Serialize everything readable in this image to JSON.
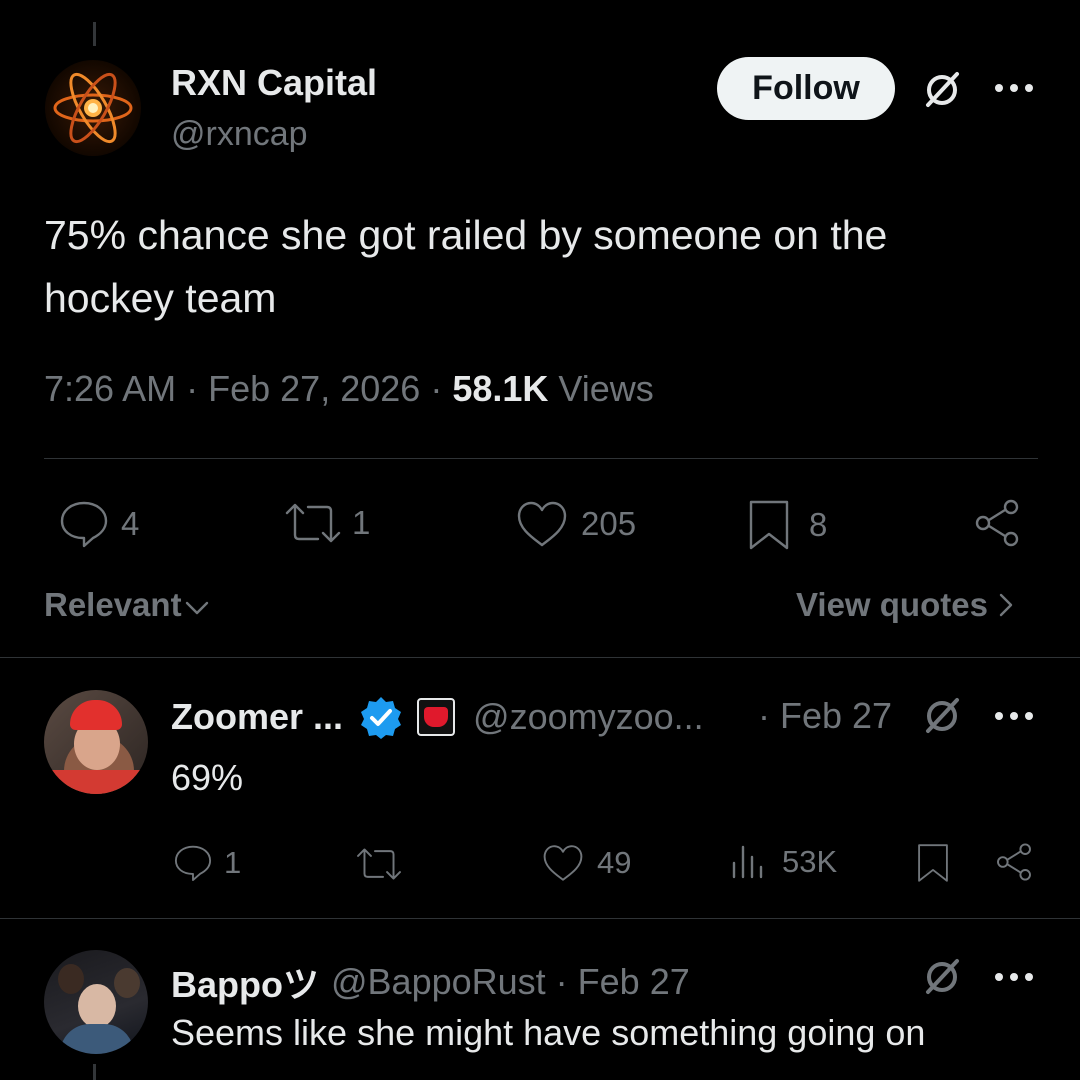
{
  "main_tweet": {
    "author_name": "RXN Capital",
    "author_handle": "@rxncap",
    "follow_label": "Follow",
    "text_line1": "75% chance she got railed by someone on the",
    "text_line2": "hockey team",
    "time": "7:26 AM",
    "date": "Feb 27, 2026",
    "sep": "·",
    "views_count": "58.1K",
    "views_label": "Views",
    "replies": "4",
    "reposts": "1",
    "likes": "205",
    "bookmarks": "8"
  },
  "sort": {
    "label": "Relevant",
    "view_quotes": "View quotes"
  },
  "replies": [
    {
      "author_name": "Zoomer ...",
      "handle": "@zoomyzoo...",
      "date": "· Feb 27",
      "text": "69%",
      "replies": "1",
      "likes": "49",
      "views": "53K",
      "verified_color": "#1d9bf0"
    },
    {
      "author_name": "Bappoツ",
      "handle": "@BappoRust",
      "date": "· Feb 27",
      "text": "Seems like she might have something going on"
    }
  ],
  "colors": {
    "background": "#000000",
    "text": "#e7e9ea",
    "muted": "#71767b",
    "verified": "#1d9bf0"
  }
}
